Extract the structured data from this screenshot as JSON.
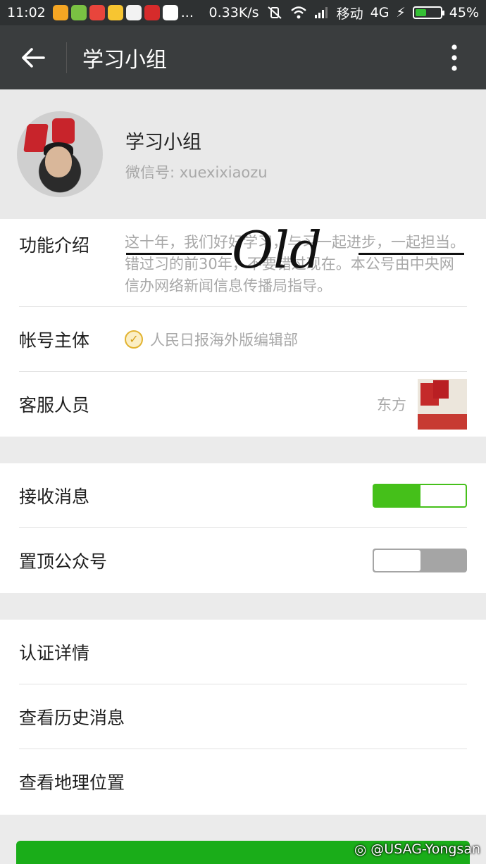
{
  "status_bar": {
    "time": "11:02",
    "more": "...",
    "speed": "0.33K/s",
    "carrier": "移动",
    "network": "4G",
    "battery": "45%",
    "battery_level": 0.45
  },
  "app_bar": {
    "title": "学习小组"
  },
  "profile": {
    "name": "学习小组",
    "wechat_id": "微信号: xuexixiaozu"
  },
  "info_section": {
    "intro_label": "功能介绍",
    "intro_text": "这十年，我们好好学习，与习一起进步，一起担当。错过习的前30年，不要错过现在。本公号由中央网信办网络新闻信息传播局指导。",
    "stamp_text": "Old",
    "owner_label": "帐号主体",
    "owner_value": "人民日报海外版编辑部",
    "service_label": "客服人员",
    "service_name": "东方"
  },
  "settings_section": {
    "receive_label": "接收消息",
    "receive_on": true,
    "pin_label": "置顶公众号",
    "pin_on": false
  },
  "links_section": {
    "items": [
      "认证详情",
      "查看历史消息",
      "查看地理位置"
    ]
  },
  "watermark": "@USAG-Yongsan",
  "colors": {
    "accent_green": "#1aad19",
    "toggle_green": "#45c01a",
    "appbar": "#3a3d3e"
  }
}
